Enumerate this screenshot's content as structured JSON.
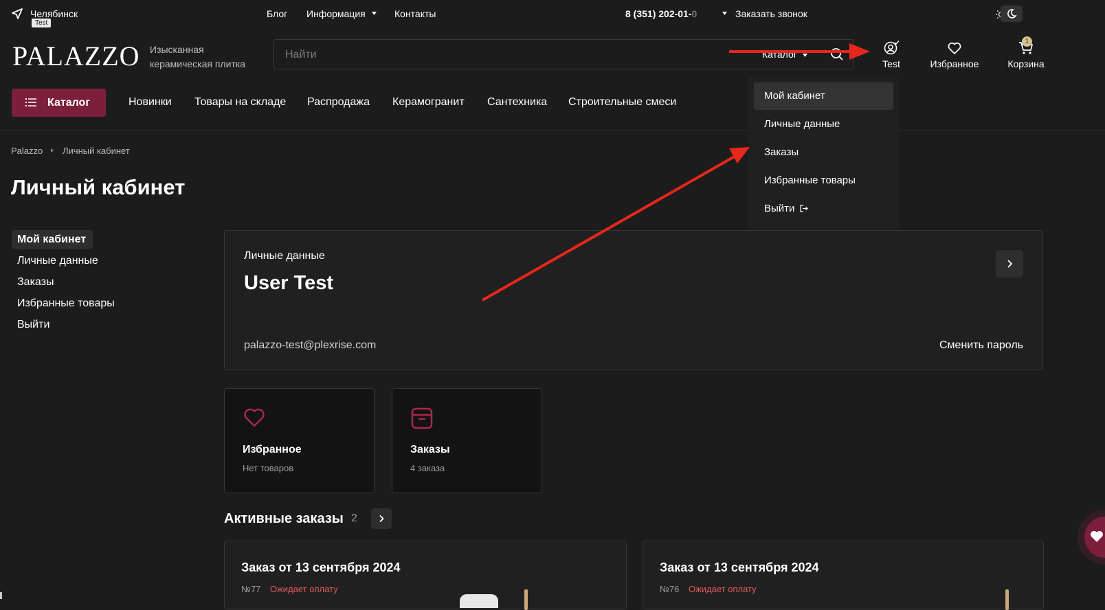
{
  "topbar": {
    "city": "Челябинск",
    "city_badge": "Test",
    "links": [
      "Блог",
      "Информация",
      "Контакты"
    ],
    "phone_main": "8 (351) 202-01-",
    "phone_fade": "0",
    "callback": "Заказать звонок"
  },
  "header": {
    "logo": "PALAZZO",
    "tagline": "Изысканная керамическая плитка",
    "search_placeholder": "Найти",
    "search_scope": "Каталог",
    "profile_label": "Test",
    "favorites_label": "Избранное",
    "cart_label": "Корзина",
    "cart_count": "1"
  },
  "nav": {
    "catalog_button": "Каталог",
    "items": [
      "Новинки",
      "Товары на складе",
      "Распродажа",
      "Керамогранит",
      "Сантехника",
      "Строительные смеси"
    ]
  },
  "breadcrumb": [
    "Palazzo",
    "Личный кабинет"
  ],
  "page_title": "Личный кабинет",
  "sidebar": {
    "items": [
      "Мой кабинет",
      "Личные данные",
      "Заказы",
      "Избранные товары",
      "Выйти"
    ]
  },
  "personal": {
    "label": "Личные данные",
    "name": "User Test",
    "email": "palazzo-test@plexrise.com",
    "change_password": "Сменить пароль"
  },
  "tiles": [
    {
      "title": "Избранное",
      "subtitle": "Нет товаров"
    },
    {
      "title": "Заказы",
      "subtitle": "4 заказа"
    }
  ],
  "active_orders": {
    "title": "Активные заказы",
    "count": "2",
    "orders": [
      {
        "title": "Заказ от 13 сентября 2024",
        "number": "№77",
        "status": "Ожидает оплату"
      },
      {
        "title": "Заказ от 13 сентября 2024",
        "number": "№76",
        "status": "Ожидает оплату"
      }
    ]
  },
  "dropdown": {
    "items": [
      "Мой кабинет",
      "Личные данные",
      "Заказы",
      "Избранные товары",
      "Выйти"
    ]
  },
  "colors": {
    "background": "#1c1c1c",
    "accent": "#7c1f3c",
    "status": "#e25a5a",
    "annotation_arrow": "#e8271c"
  }
}
